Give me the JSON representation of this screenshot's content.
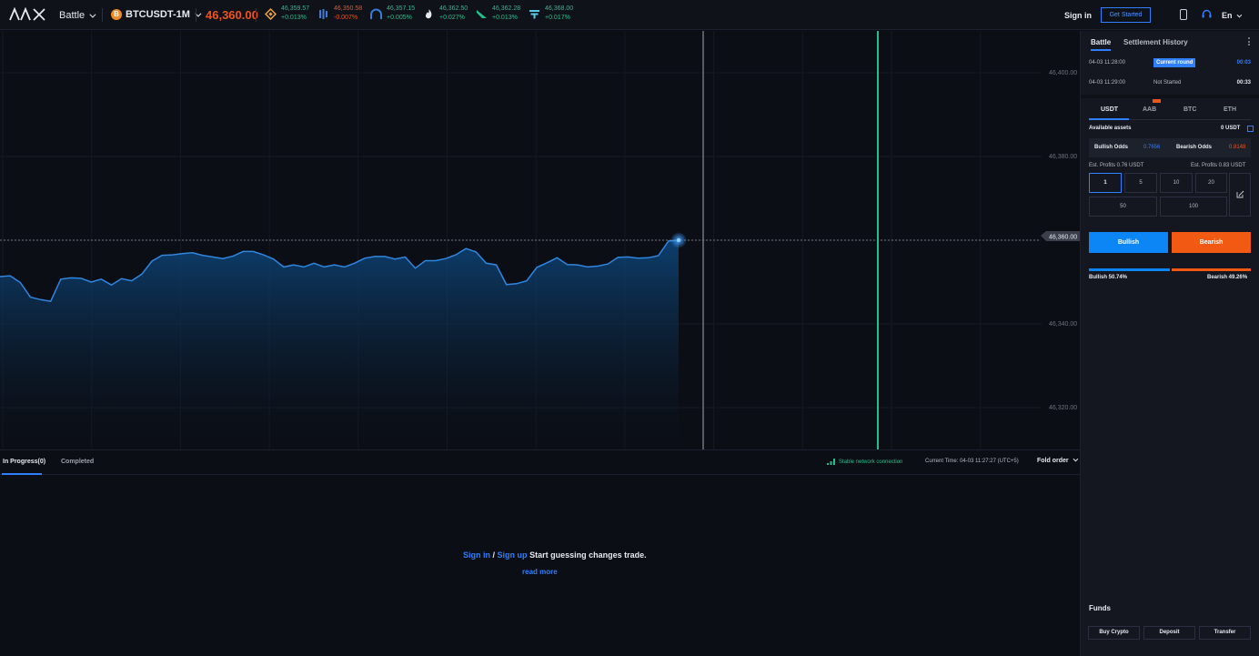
{
  "header": {
    "logo_text": "AAX",
    "battle_label": "Battle",
    "pair_label": "BTCUSDT-1M",
    "btc_symbol": "B",
    "price": "46,360.00",
    "tickers": [
      {
        "icon": "binance-icon",
        "price": "46,359.57",
        "change": "+0.013%",
        "trend": "up"
      },
      {
        "icon": "exchange-bars-icon",
        "price": "46,350.58",
        "change": "-0.007%",
        "trend": "down"
      },
      {
        "icon": "exchange-arch-icon",
        "price": "46,357.15",
        "change": "+0.005%",
        "trend": "up"
      },
      {
        "icon": "huobi-flame-icon",
        "price": "46,362.50",
        "change": "+0.027%",
        "trend": "up"
      },
      {
        "icon": "exchange-arrow-icon",
        "price": "46,362.28",
        "change": "+0.013%",
        "trend": "up"
      },
      {
        "icon": "exchange-grid-icon",
        "price": "46,368.00",
        "change": "+0.017%",
        "trend": "up"
      }
    ],
    "signin_label": "Sign in",
    "get_started_label": "Get Started",
    "lang_label": "En"
  },
  "chart_data": {
    "type": "area",
    "ylim": [
      46310,
      46410
    ],
    "y_ticks": [
      "46,400.00",
      "46,380.00",
      "46,360.00",
      "46,340.00",
      "46,320.00"
    ],
    "y_tick_values": [
      46400,
      46380,
      46360,
      46340,
      46320
    ],
    "current_price_label": "46,360.00",
    "current_price": 46360,
    "series": [
      {
        "values": [
          46351.3,
          46351.5,
          46349.9,
          46346.4,
          46345.8,
          46345.4,
          46350.7,
          46351.0,
          46350.9,
          46350.0,
          46350.7,
          46349.3,
          46350.8,
          46350.3,
          46351.9,
          46355.0,
          46356.4,
          46356.5,
          46356.8,
          46357.0,
          46356.4,
          46356.0,
          46355.6,
          46356.2,
          46357.3,
          46357.3,
          46356.5,
          46355.5,
          46353.6,
          46354.1,
          46353.6,
          46354.5,
          46353.6,
          46354.1,
          46353.6,
          46354.5,
          46355.7,
          46356.1,
          46356.1,
          46355.5,
          46356.0,
          46353.3,
          46355.1,
          46355.1,
          46355.6,
          46356.5,
          46358.0,
          46357.2,
          46354.5,
          46354.1,
          46349.4,
          46349.6,
          46350.3,
          46353.5,
          46354.6,
          46355.8,
          46354.2,
          46354.1,
          46353.6,
          46353.8,
          46354.3,
          46355.9,
          46356.0,
          46355.7,
          46355.8,
          46356.3,
          46359.8,
          46360.0
        ]
      }
    ],
    "grid": true,
    "markers": [
      {
        "name": "round-start-line",
        "color": "#8a8f99"
      },
      {
        "name": "settlement-line",
        "color": "#23c18a"
      }
    ]
  },
  "orders": {
    "tab_in_progress": "In Progress(0)",
    "tab_completed": "Completed",
    "network_status": "Stable network connection",
    "current_time": "Current Time: 04-03 11:27:27 (UTC+5)",
    "fold_order": "Fold order",
    "sign_in": "Sign in",
    "slash": "/",
    "sign_up": "Sign up",
    "start_text": "Start guessing changes trade.",
    "read_more": "read more"
  },
  "panel": {
    "tab_battle": "Battle",
    "tab_settlement": "Settlement History",
    "rounds": [
      {
        "time": "04-03 11:28:00",
        "status": "Current round",
        "countdown": "00:03"
      },
      {
        "time": "04-03 11:29:00",
        "status": "Not Started",
        "countdown": "00:33"
      }
    ],
    "currencies": [
      "USDT",
      "AAB",
      "BTC",
      "ETH"
    ],
    "available_label": "Available assets",
    "available_value": "0 USDT",
    "bullish_odds_label": "Bullish Odds",
    "bullish_odds": "0.7656",
    "bearish_odds_label": "Bearish Odds",
    "bearish_odds": "0.8148",
    "est_left": "Est. Profits 0.76 USDT",
    "est_right": "Est. Profits 0.83 USDT",
    "amounts": [
      "1",
      "5",
      "10",
      "20",
      "50",
      "100"
    ],
    "bullish_btn": "Bullish",
    "bearish_btn": "Bearish",
    "bullish_pct": 50.74,
    "bearish_pct": 49.26,
    "bullish_ratio_label": "Bullish 50.74%",
    "bearish_ratio_label": "Bearish 49.26%",
    "funds_title": "Funds",
    "fund_buttons": [
      "Buy Crypto",
      "Deposit",
      "Transfer"
    ]
  },
  "colors": {
    "bull": "#0c86f5",
    "bear": "#f25a14",
    "up": "#23c18a",
    "down": "#f0531c",
    "accent": "#2f7fff"
  }
}
